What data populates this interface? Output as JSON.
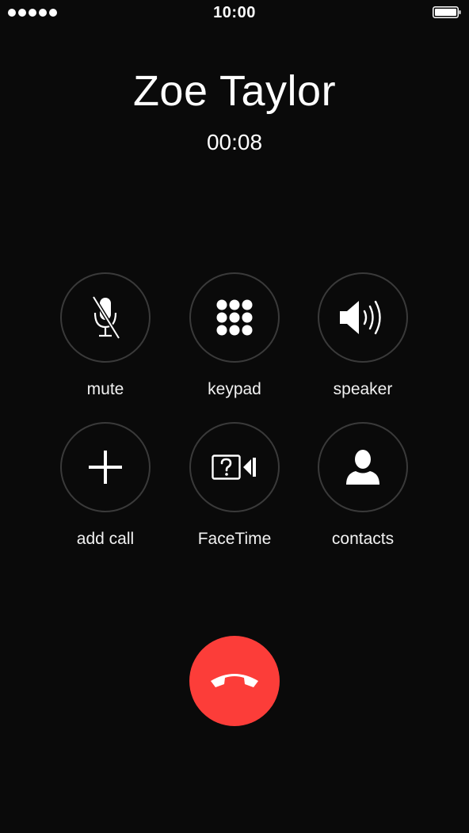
{
  "status_bar": {
    "time": "10:00",
    "signal_dots": 5,
    "battery_icon": "battery-full-icon"
  },
  "call": {
    "caller_name": "Zoe Taylor",
    "duration": "00:08"
  },
  "controls": [
    {
      "id": "mute",
      "label": "mute",
      "icon": "microphone-muted-icon"
    },
    {
      "id": "keypad",
      "label": "keypad",
      "icon": "keypad-grid-icon"
    },
    {
      "id": "speaker",
      "label": "speaker",
      "icon": "speaker-icon"
    },
    {
      "id": "add_call",
      "label": "add call",
      "icon": "plus-icon"
    },
    {
      "id": "facetime",
      "label": "FaceTime",
      "icon": "facetime-unknown-icon"
    },
    {
      "id": "contacts",
      "label": "contacts",
      "icon": "contact-person-icon"
    }
  ],
  "end_call": {
    "icon": "phone-hangup-icon"
  },
  "colors": {
    "background": "#0a0a0a",
    "end_call": "#fc3d39",
    "circle_border": "#3a3a3a",
    "text": "#ffffff"
  }
}
